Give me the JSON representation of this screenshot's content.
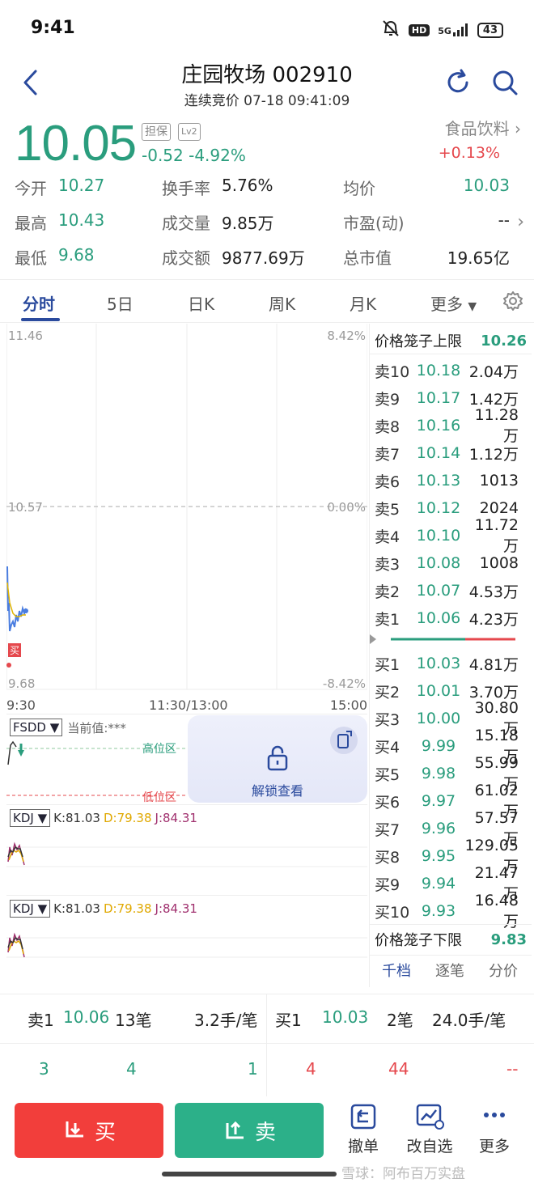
{
  "status_bar": {
    "time": "9:41",
    "network": "5G",
    "hd": "HD",
    "battery": "43"
  },
  "header": {
    "title": "庄园牧场 002910",
    "subtitle": "连续竞价 07-18 09:41:09"
  },
  "quote": {
    "price": "10.05",
    "tag_danbao": "担保",
    "tag_lv2": "Lv2",
    "change": "-0.52  -4.92%",
    "sector_name": "食品饮料",
    "sector_change": "+0.13%",
    "rows": [
      [
        {
          "label": "今开",
          "value": "10.27"
        },
        {
          "label": "换手率",
          "value": "5.76%"
        },
        {
          "label": "均价",
          "value": "10.03"
        }
      ],
      [
        {
          "label": "最高",
          "value": "10.43"
        },
        {
          "label": "成交量",
          "value": "9.85万"
        },
        {
          "label": "市盈(动)",
          "value": "--"
        }
      ],
      [
        {
          "label": "最低",
          "value": "9.68"
        },
        {
          "label": "成交额",
          "value": "9877.69万"
        },
        {
          "label": "总市值",
          "value": "19.65亿"
        }
      ]
    ]
  },
  "tabs": [
    "分时",
    "5日",
    "日K",
    "周K",
    "月K",
    "更多"
  ],
  "chart": {
    "y_top": "11.46",
    "y_mid": "10.57",
    "y_bottom": "9.68",
    "pct_top": "8.42%",
    "pct_mid": "0.00%",
    "pct_bottom": "-8.42%",
    "buy_marker": "买",
    "time_start": "9:30",
    "time_mid": "11:30/13:00",
    "time_end": "15:00"
  },
  "indicators": {
    "fsdd": {
      "name": "FSDD",
      "current": "当前值:***",
      "high_zone": "高位区",
      "low_zone": "低位区",
      "unlock": "解锁查看"
    },
    "kdj1": {
      "name": "KDJ",
      "k": "K:81.03",
      "d": "D:79.38",
      "j": "J:84.31"
    },
    "kdj2": {
      "name": "KDJ",
      "k": "K:81.03",
      "d": "D:79.38",
      "j": "J:84.31"
    }
  },
  "order_book": {
    "upper_limit_label": "价格笼子上限",
    "upper_limit_value": "10.26",
    "asks": [
      {
        "label": "卖10",
        "price": "10.18",
        "vol": "2.04万"
      },
      {
        "label": "卖9",
        "price": "10.17",
        "vol": "1.42万"
      },
      {
        "label": "卖8",
        "price": "10.16",
        "vol": "11.28万"
      },
      {
        "label": "卖7",
        "price": "10.14",
        "vol": "1.12万"
      },
      {
        "label": "卖6",
        "price": "10.13",
        "vol": "1013"
      },
      {
        "label": "卖5",
        "price": "10.12",
        "vol": "2024"
      },
      {
        "label": "卖4",
        "price": "10.10",
        "vol": "11.72万"
      },
      {
        "label": "卖3",
        "price": "10.08",
        "vol": "1008"
      },
      {
        "label": "卖2",
        "price": "10.07",
        "vol": "4.53万"
      },
      {
        "label": "卖1",
        "price": "10.06",
        "vol": "4.23万"
      }
    ],
    "bids": [
      {
        "label": "买1",
        "price": "10.03",
        "vol": "4.81万"
      },
      {
        "label": "买2",
        "price": "10.01",
        "vol": "3.70万"
      },
      {
        "label": "买3",
        "price": "10.00",
        "vol": "30.80万"
      },
      {
        "label": "买4",
        "price": "9.99",
        "vol": "15.18万"
      },
      {
        "label": "买5",
        "price": "9.98",
        "vol": "55.99万"
      },
      {
        "label": "买6",
        "price": "9.97",
        "vol": "61.02万"
      },
      {
        "label": "买7",
        "price": "9.96",
        "vol": "57.57万"
      },
      {
        "label": "买8",
        "price": "9.95",
        "vol": "129.05万"
      },
      {
        "label": "买9",
        "price": "9.94",
        "vol": "21.47万"
      },
      {
        "label": "买10",
        "price": "9.93",
        "vol": "16.48万"
      }
    ],
    "lower_limit_label": "价格笼子下限",
    "lower_limit_value": "9.83",
    "tabs": [
      "千档",
      "逐笔",
      "分价"
    ]
  },
  "summary": {
    "sell1_label": "卖1",
    "sell1_price": "10.06",
    "sell1_count": "13笔",
    "sell1_avg": "3.2手/笔",
    "buy1_label": "买1",
    "buy1_price": "10.03",
    "buy1_count": "2笔",
    "buy1_avg": "24.0手/笔",
    "row2": [
      "3",
      "4",
      "1",
      "4",
      "44",
      "--"
    ]
  },
  "bottom_bar": {
    "buy": "买",
    "sell": "卖",
    "cancel": "撤单",
    "edit_watchlist": "改自选",
    "more": "更多"
  },
  "watermark": "雪球：阿布百万实盘",
  "colors": {
    "up": "#e5484d",
    "down": "#2a9d7d",
    "accent": "#2a4a9d"
  }
}
